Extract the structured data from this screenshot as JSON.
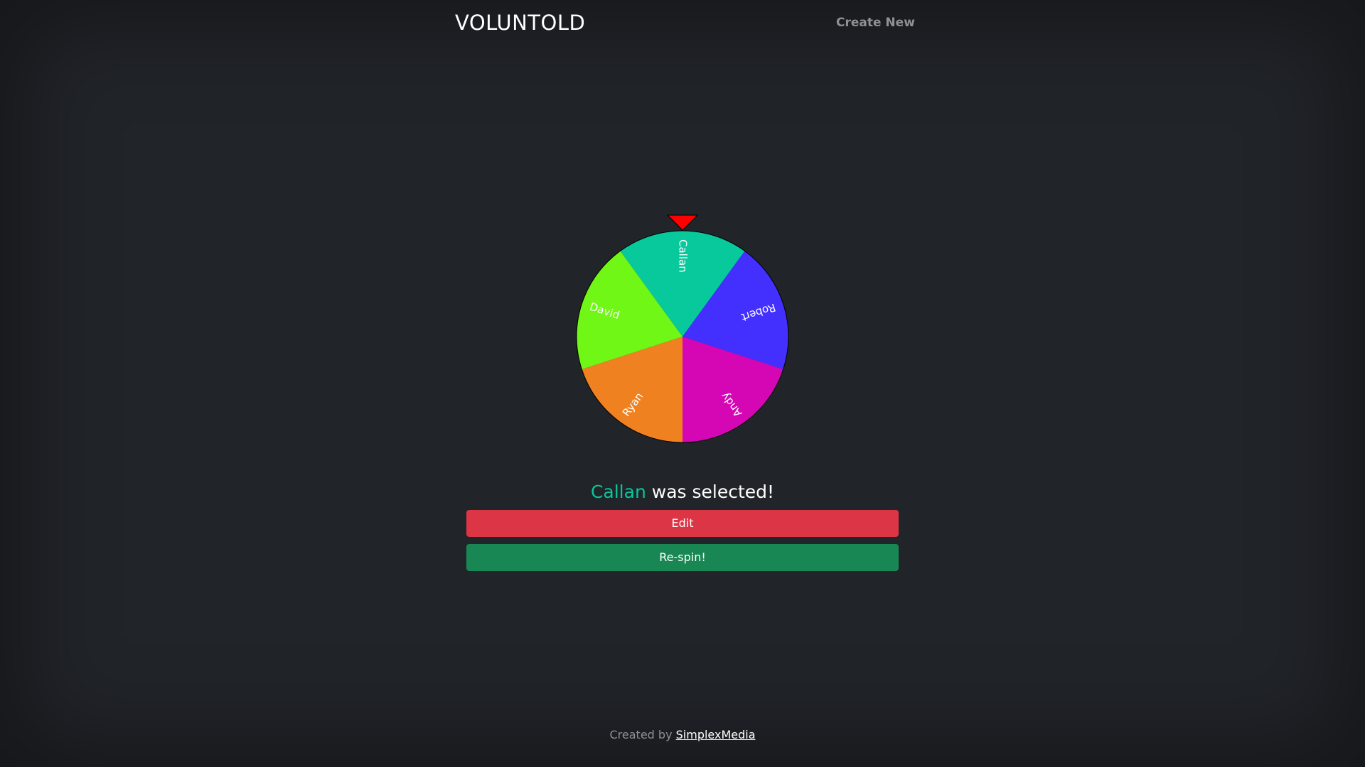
{
  "header": {
    "brand": "VOLUNTOLD",
    "nav_create_new": "Create New"
  },
  "wheel": {
    "pointer_color": "#ff0000",
    "segments": [
      {
        "label": "Callan",
        "color": "#08c99b"
      },
      {
        "label": "Robert",
        "color": "#4330ff"
      },
      {
        "label": "Andy",
        "color": "#d506b4"
      },
      {
        "label": "Ryan",
        "color": "#f08120"
      },
      {
        "label": "David",
        "color": "#70f716"
      }
    ]
  },
  "result": {
    "selected_name": "Callan",
    "suffix": " was selected!",
    "accent_color": "#08c69a"
  },
  "buttons": {
    "edit_label": "Edit",
    "respin_label": "Re-spin!"
  },
  "footer": {
    "prefix": "Created by ",
    "link_text": "SimplexMedia"
  }
}
